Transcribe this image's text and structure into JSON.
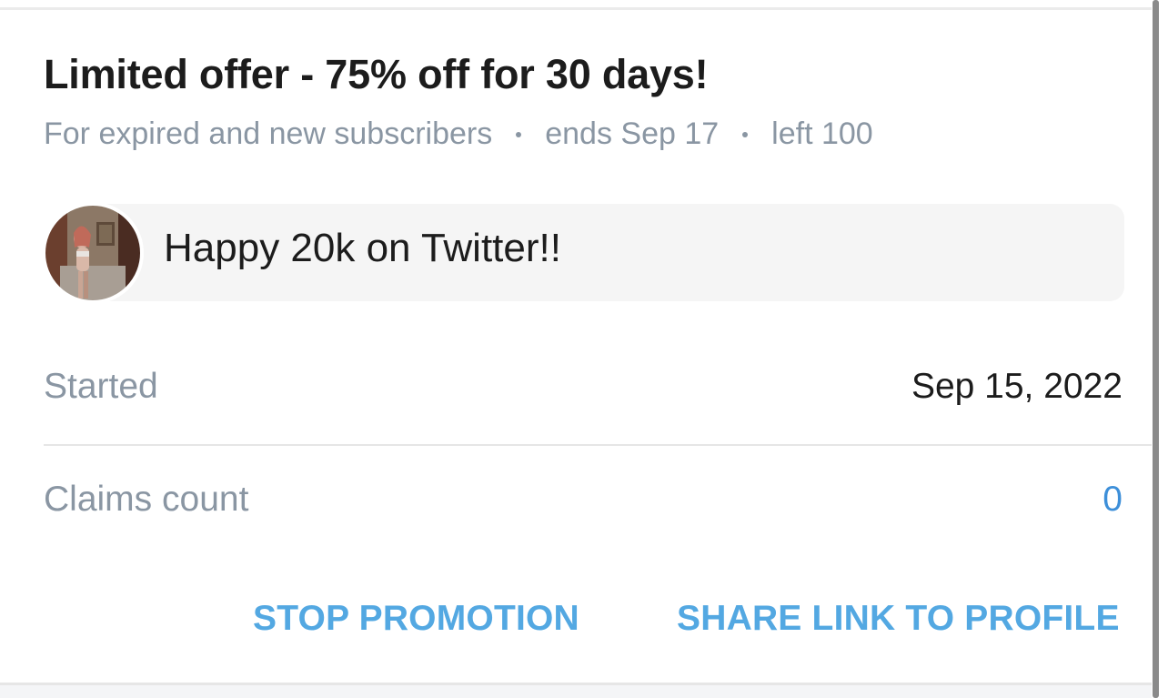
{
  "promotion": {
    "title": "Limited offer - 75% off for 30 days!",
    "meta": {
      "audience": "For expired and new subscribers",
      "ends": "ends Sep 17",
      "left": "left 100"
    },
    "message": "Happy 20k on Twitter!!",
    "details": {
      "started_label": "Started",
      "started_value": "Sep 15, 2022",
      "claims_label": "Claims count",
      "claims_value": "0"
    },
    "actions": {
      "stop_label": "STOP PROMOTION",
      "share_label": "SHARE LINK TO PROFILE"
    }
  },
  "colors": {
    "accent": "#53a8e2",
    "link_value": "#3d8fd9",
    "muted_text": "#8a96a3",
    "primary_text": "#1c1c1c",
    "bubble_bg": "#f5f5f5"
  }
}
